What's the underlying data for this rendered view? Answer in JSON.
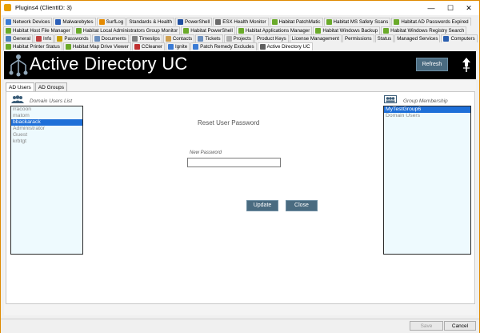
{
  "window": {
    "title": "Plugins4   (ClientID: 3)",
    "controls": [
      "—",
      "☐",
      "✕"
    ]
  },
  "tabs": {
    "row1": [
      {
        "label": "Network Devices",
        "color": "#3a7bd5"
      },
      {
        "label": "Malwarebytes",
        "color": "#2b5fb8"
      },
      {
        "label": "SurfLog",
        "color": "#e58a00"
      },
      {
        "label": "Standards & Health",
        "color": ""
      },
      {
        "label": "PowerShell",
        "color": "#1f4fa0"
      },
      {
        "label": "ESX Health Monitor",
        "color": "#6a6a6a"
      },
      {
        "label": "Habitat PatchMatic",
        "color": "#6aaa2a"
      },
      {
        "label": "Habitat MS Safety Scans",
        "color": "#6aaa2a"
      },
      {
        "label": "Habitat AD Passwords Expired",
        "color": "#6aaa2a"
      }
    ],
    "row2": [
      {
        "label": "Habitat Host File Manager",
        "color": "#6aaa2a"
      },
      {
        "label": "Habitat Local Administrators Group Monitor",
        "color": "#6aaa2a"
      },
      {
        "label": "Habitat PowerShell",
        "color": "#6aaa2a"
      },
      {
        "label": "Habitat Applications Manager",
        "color": "#6aaa2a"
      },
      {
        "label": "Habitat Windows Backup",
        "color": "#6aaa2a"
      },
      {
        "label": "Habitat Windows Registry Search",
        "color": "#6aaa2a"
      }
    ],
    "row3": [
      {
        "label": "General",
        "color": "#4a7fbf"
      },
      {
        "label": "Info",
        "color": "#c04040"
      },
      {
        "label": "Passwords",
        "color": "#caa000"
      },
      {
        "label": "Documents",
        "color": "#6a8fbf"
      },
      {
        "label": "Timeslips",
        "color": "#808080"
      },
      {
        "label": "Contacts",
        "color": "#d0a050"
      },
      {
        "label": "Tickets",
        "color": "#6a8fbf"
      },
      {
        "label": "Projects",
        "color": "#b0b0b0"
      },
      {
        "label": "Product Keys",
        "color": ""
      },
      {
        "label": "License Management",
        "color": ""
      },
      {
        "label": "Permissions",
        "color": ""
      },
      {
        "label": "Status",
        "color": ""
      },
      {
        "label": "Managed Services",
        "color": ""
      },
      {
        "label": "Computers",
        "color": "#2a5fb0"
      }
    ],
    "row4": [
      {
        "label": "Habitat Printer Status",
        "color": "#6aaa2a"
      },
      {
        "label": "Habitat Map Drive Viewer",
        "color": "#6aaa2a"
      },
      {
        "label": "CCleaner",
        "color": "#c03030"
      },
      {
        "label": "Ignite",
        "color": "#3a7bd5"
      },
      {
        "label": "Patch Remedy Excludes",
        "color": "#3a7bd5"
      },
      {
        "label": "Active Directory UC",
        "color": "#606060"
      }
    ]
  },
  "banner": {
    "title": "Active Directory UC",
    "refresh_label": "Refresh"
  },
  "subtabs": [
    "AD Users",
    "AD Groups"
  ],
  "users": {
    "label": "Domain Users List",
    "items": [
      "rracoon",
      "matom",
      "bbackarack",
      "Administrator",
      "Guest",
      "krbtgt"
    ],
    "selected_index": 2
  },
  "groups": {
    "label": "Group Membership",
    "items": [
      "MyTestGroup6",
      "Domain Users"
    ],
    "selected_index": 0
  },
  "reset": {
    "heading": "Reset User Password",
    "field_label": "New Password",
    "field_value": "",
    "update_label": "Update",
    "close_label": "Close"
  },
  "footer": {
    "save_label": "Save",
    "cancel_label": "Cancel"
  }
}
